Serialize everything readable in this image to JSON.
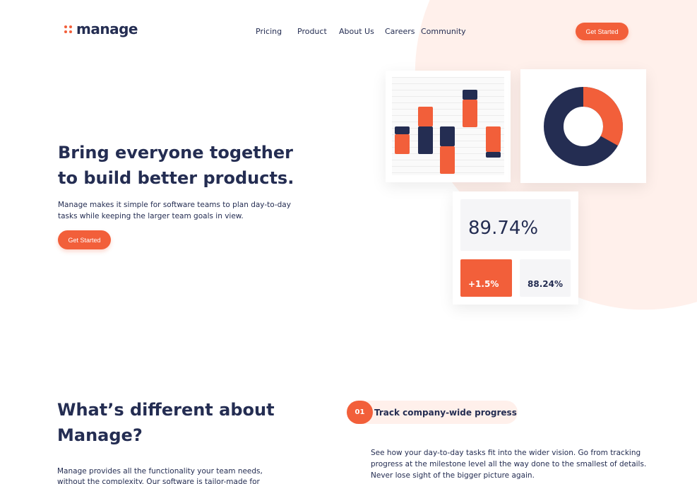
{
  "brand": {
    "name": "manage",
    "accent": "#F25F3A",
    "navy": "#242D52",
    "tint": "#FFF0EB"
  },
  "nav": {
    "items": [
      {
        "label": "Pricing"
      },
      {
        "label": "Product"
      },
      {
        "label": "About Us"
      },
      {
        "label": "Careers"
      },
      {
        "label": "Community"
      }
    ],
    "cta": "Get Started"
  },
  "hero": {
    "title": "Bring everyone together to build better products.",
    "description": "Manage makes it simple for software teams to plan day-to-day tasks while keeping the larger team goals in view.",
    "cta": "Get Started"
  },
  "dashboard": {
    "bar_chart": {
      "columns": [
        {
          "navy": 0.08,
          "orange": 0.2
        },
        {
          "orange": 0.2,
          "navy": 0.28
        },
        {
          "navy": 0.2,
          "orange": 0.28
        },
        {
          "navy": 0.1,
          "orange": 0.28
        },
        {
          "orange": 0.26,
          "navy": 0.06
        }
      ]
    },
    "donut": {
      "orange_share": 0.33,
      "navy_share": 0.67
    },
    "stats": {
      "primary": "89.74%",
      "change": "+1.5%",
      "secondary": "88.24%"
    }
  },
  "features_section": {
    "title": "What’s different about Manage?",
    "description": "Manage provides all the functionality your team needs, without the complexity. Our software is tailor-made for",
    "feature": {
      "number": "01",
      "title": "Track company-wide progress",
      "description": "See how your day-to-day tasks fit into the wider vision. Go from tracking progress at the milestone level all the way done to the smallest of details. Never lose sight of the bigger picture again."
    }
  }
}
